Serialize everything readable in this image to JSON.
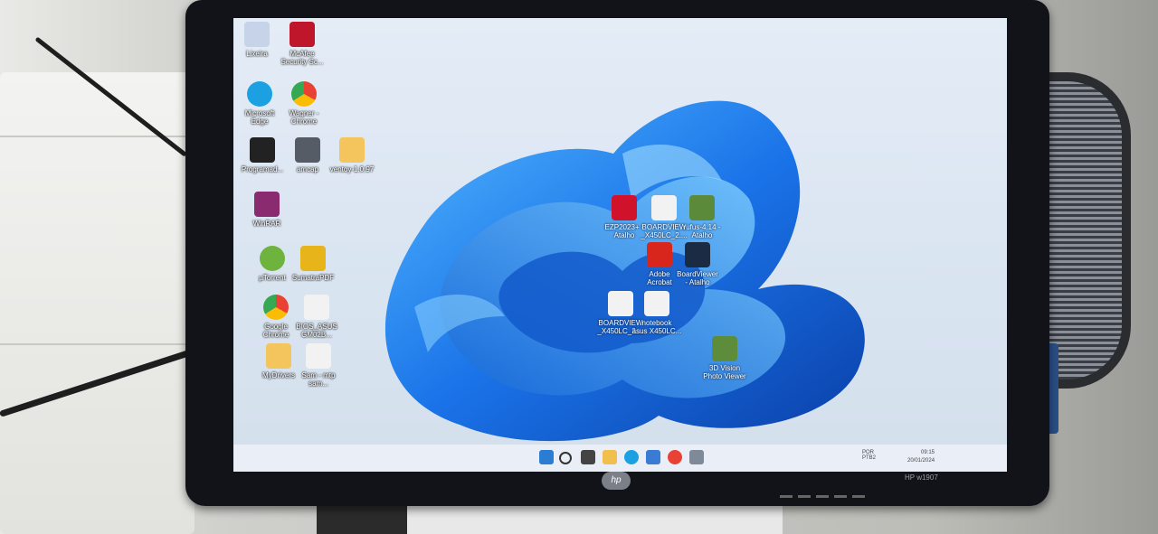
{
  "monitor": {
    "brand_logo": "hp",
    "model": "HP w1907"
  },
  "desktop_icons": [
    {
      "id": "recycle",
      "label": "Lixeira",
      "icon": "recycle-bin-icon",
      "color": "#c7d3e8"
    },
    {
      "id": "mcafee",
      "label": "McAfee\nSecurity Sc...",
      "icon": "mcafee-icon",
      "color": "#c0162c"
    },
    {
      "id": "edge",
      "label": "Microsoft\nEdge",
      "icon": "edge-icon",
      "color": "#1ba1e2"
    },
    {
      "id": "wagner",
      "label": "Wagner -\nChrome",
      "icon": "chrome-profile-icon",
      "color": "#e94235"
    },
    {
      "id": "programador",
      "label": "Programad...",
      "icon": "chip-programmer-icon",
      "color": "#222222"
    },
    {
      "id": "amcap",
      "label": "amcap",
      "icon": "camera-icon",
      "color": "#555c66"
    },
    {
      "id": "ventoy",
      "label": "ventoy-1.0.97",
      "icon": "folder-icon",
      "color": "#f4c55c"
    },
    {
      "id": "winrar",
      "label": "WinRAR",
      "icon": "winrar-icon",
      "color": "#8a2a6f"
    },
    {
      "id": "utorrent",
      "label": "µTorrent",
      "icon": "utorrent-icon",
      "color": "#6fb33f"
    },
    {
      "id": "sumatra",
      "label": "SumatraPDF",
      "icon": "pdf-reader-icon",
      "color": "#e7b41a"
    },
    {
      "id": "chrome",
      "label": "Google\nChrome",
      "icon": "chrome-icon",
      "color": "#e94235"
    },
    {
      "id": "bios",
      "label": "BIOS_ASUS\nGM02B...",
      "icon": "file-icon",
      "color": "#f2f2f2"
    },
    {
      "id": "mydrivers",
      "label": "MyDrivers",
      "icon": "folder-icon",
      "color": "#f4c55c"
    },
    {
      "id": "samsung",
      "label": "Sam - mtp\nsam...",
      "icon": "file-icon",
      "color": "#f2f2f2"
    },
    {
      "id": "ezp",
      "label": "EZP2023+ -\nAtalho",
      "icon": "ezp-programmer-icon",
      "color": "#d0122a"
    },
    {
      "id": "boardview1",
      "label": "BOARDVIEW\n_X450LC_2....",
      "icon": "file-icon",
      "color": "#f2f2f2"
    },
    {
      "id": "rufus",
      "label": "rufus-4.14 -\nAtalho",
      "icon": "rufus-usb-icon",
      "color": "#5a8a3a"
    },
    {
      "id": "acrobat",
      "label": "Adobe\nAcrobat",
      "icon": "acrobat-icon",
      "color": "#d9261c"
    },
    {
      "id": "boardviewer",
      "label": "BoardViewer\n- Atalho",
      "icon": "boardviewer-icon",
      "color": "#1c2b44"
    },
    {
      "id": "boardview2",
      "label": "BOARDVIEW\n_X450LC_2....",
      "icon": "file-icon",
      "color": "#f2f2f2"
    },
    {
      "id": "notebook",
      "label": "notebook\nasus X450LC...",
      "icon": "file-icon",
      "color": "#f2f2f2"
    },
    {
      "id": "3dvision",
      "label": "3D Vision\nPhoto Viewer",
      "icon": "photo-viewer-icon",
      "color": "#5d8d3a"
    }
  ],
  "taskbar": {
    "apps": [
      {
        "name": "start-icon",
        "color": "#2b7cd3"
      },
      {
        "name": "search-icon",
        "color": "#333333"
      },
      {
        "name": "task-view-icon",
        "color": "#444444"
      },
      {
        "name": "file-explorer-icon",
        "color": "#f1c04c"
      },
      {
        "name": "edge-icon",
        "color": "#1ba1e2"
      },
      {
        "name": "store-icon",
        "color": "#3a7bd5"
      },
      {
        "name": "chrome-icon",
        "color": "#e94235"
      },
      {
        "name": "app-icon",
        "color": "#7f8a99"
      }
    ],
    "time": "09:15",
    "date": "20/01/2024",
    "lang": "POR\nPTB2"
  },
  "colors": {
    "bloom_main": "#1a73e8",
    "bloom_light": "#4fb3ff",
    "bloom_dark": "#0a3fa8"
  }
}
